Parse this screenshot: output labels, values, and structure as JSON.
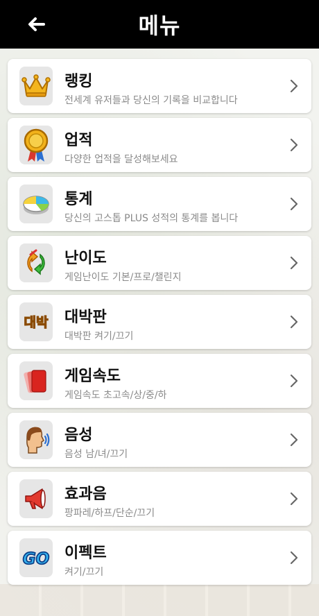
{
  "header": {
    "title": "메뉴",
    "back_icon": "arrow-left-icon"
  },
  "menu": {
    "items": [
      {
        "title": "랭킹",
        "desc": "전세계 유저들과 당신의 기록을 비교합니다",
        "icon": "crown-icon"
      },
      {
        "title": "업적",
        "desc": "다양한 업적을 달성해보세요",
        "icon": "medal-icon"
      },
      {
        "title": "통계",
        "desc": "당신의 고스톱 PLUS 성적의 통계를 봅니다",
        "icon": "pie-chart-icon"
      },
      {
        "title": "난이도",
        "desc": "게임난이도 기본/프로/챌린지",
        "icon": "swap-arrows-icon"
      },
      {
        "title": "대박판",
        "desc": "대박판 켜기/끄기",
        "icon": "daebak-badge-icon"
      },
      {
        "title": "게임속도",
        "desc": "게임속도 초고속/상/중/하",
        "icon": "cards-icon"
      },
      {
        "title": "음성",
        "desc": "음성 남/녀/끄기",
        "icon": "speaking-head-icon"
      },
      {
        "title": "효과음",
        "desc": "팡파레/하프/단순/끄기",
        "icon": "megaphone-icon"
      },
      {
        "title": "이펙트",
        "desc": "켜기/끄기",
        "icon": "go-badge-icon"
      }
    ],
    "chevron_icon": "chevron-right-icon",
    "badge_text_daebak": "대박",
    "badge_text_go": "GO"
  }
}
